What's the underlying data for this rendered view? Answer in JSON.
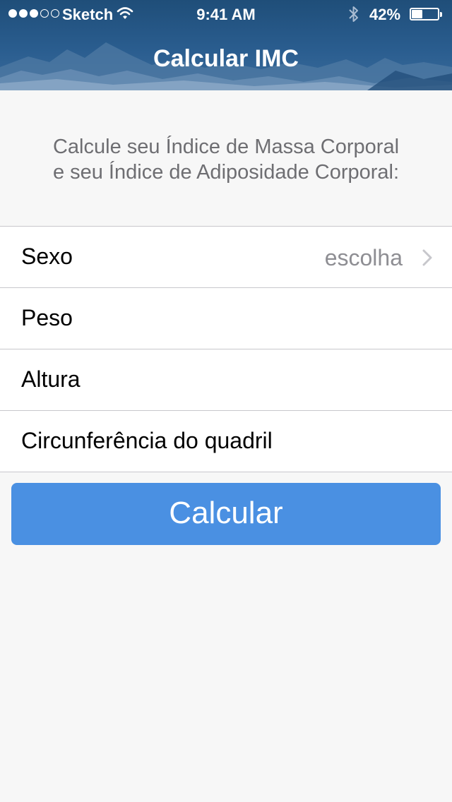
{
  "status_bar": {
    "carrier": "Sketch",
    "time": "9:41 AM",
    "battery_percent": "42%",
    "battery_level": 0.42,
    "signal_bars_filled": 3,
    "signal_bars_total": 5
  },
  "nav": {
    "title": "Calcular IMC"
  },
  "intro": {
    "line1": "Calcule seu Índice de Massa Corporal",
    "line2": "e seu Índice de Adiposidade Corporal:"
  },
  "form": {
    "rows": [
      {
        "label": "Sexo",
        "value": "escolha"
      },
      {
        "label": "Peso"
      },
      {
        "label": "Altura"
      },
      {
        "label": "Circunferência do quadril"
      }
    ]
  },
  "action": {
    "label": "Calcular"
  },
  "colors": {
    "accent": "#4a90e2",
    "header": "#2a5d8f",
    "background": "#f7f7f7"
  },
  "icons": [
    "wifi-icon",
    "bluetooth-icon",
    "battery-icon",
    "chevron-right-icon"
  ]
}
